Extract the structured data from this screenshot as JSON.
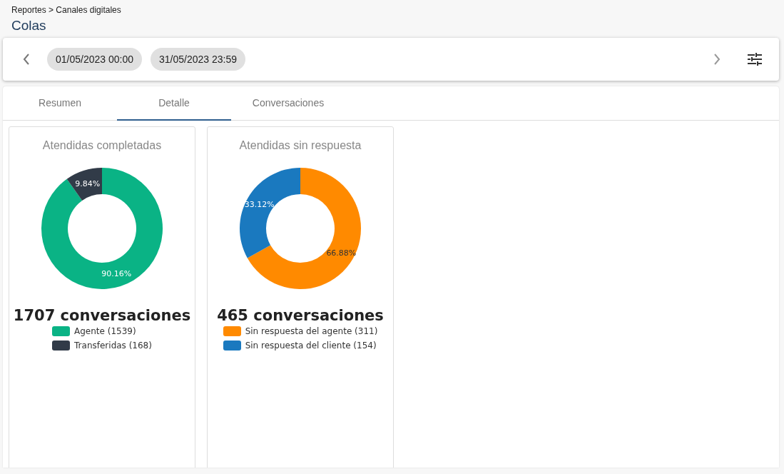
{
  "breadcrumb": "Reportes > Canales digitales",
  "title": "Colas",
  "date_range": {
    "from": "01/05/2023 00:00",
    "to": "31/05/2023 23:59"
  },
  "tabs": [
    {
      "label": "Resumen",
      "selected": false
    },
    {
      "label": "Detalle",
      "selected": true
    },
    {
      "label": "Conversaciones",
      "selected": false
    }
  ],
  "cards": [
    {
      "title": "Atendidas completadas",
      "total": "1707 conversaciones",
      "chart_data": {
        "type": "donut",
        "series": [
          {
            "values": [
              90.16,
              9.84
            ]
          }
        ],
        "colors": [
          "#0ab385",
          "#313b48"
        ],
        "value_labels": [
          "90.16%",
          "9.84%"
        ]
      },
      "legend": [
        {
          "label": "Agente (1539)",
          "color": "#0ab385"
        },
        {
          "label": "Transferidas (168)",
          "color": "#313b48"
        }
      ]
    },
    {
      "title": "Atendidas sin respuesta",
      "total": "465 conversaciones",
      "chart_data": {
        "type": "donut",
        "series": [
          {
            "values": [
              66.88,
              33.12
            ]
          }
        ],
        "colors": [
          "#ff8a00",
          "#1a79bf"
        ],
        "value_labels": [
          "66.88%",
          "33.12%"
        ]
      },
      "legend": [
        {
          "label": "Sin respuesta del agente (311)",
          "color": "#ff8a00"
        },
        {
          "label": "Sin respuesta del cliente (154)",
          "color": "#1a79bf"
        }
      ]
    }
  ]
}
